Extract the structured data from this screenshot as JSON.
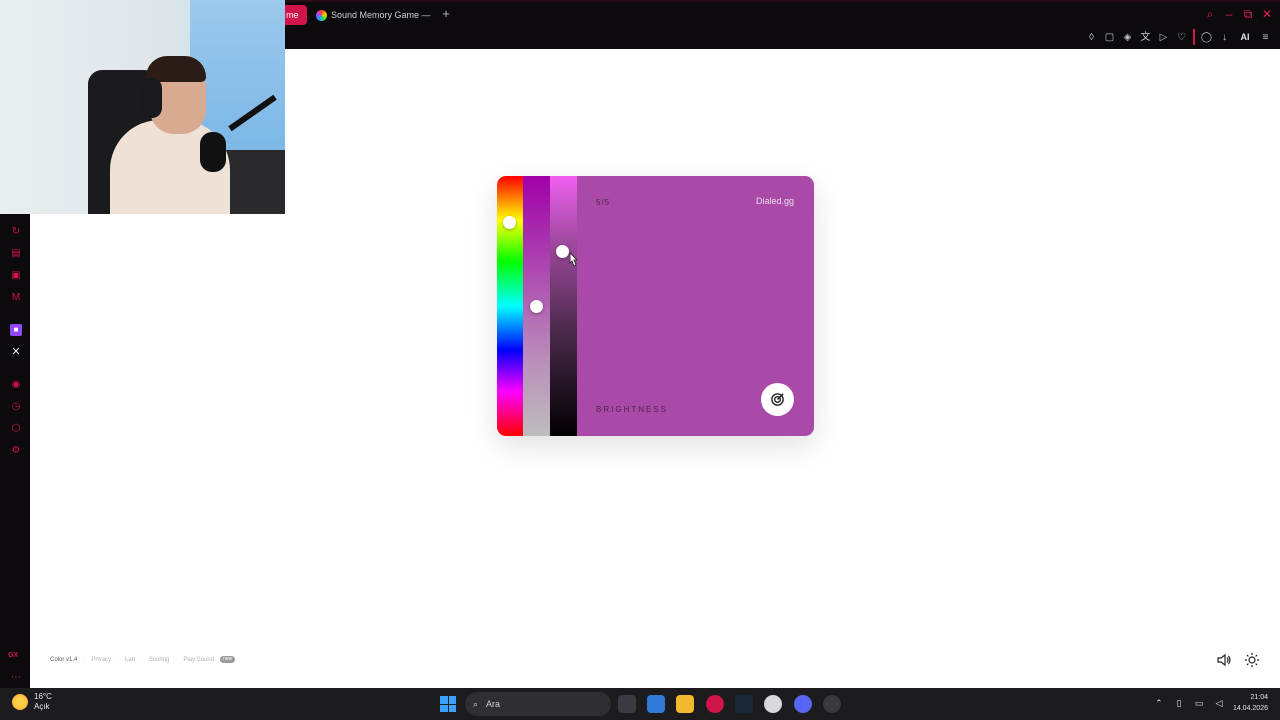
{
  "browser": {
    "active_tab_label": "me",
    "tab_label": "Sound Memory Game — H",
    "new_tab_symbol": "+",
    "toolbar_ai_label": "AI"
  },
  "game": {
    "round_counter": "5/5",
    "brand": "Dialed.gg",
    "stage_label": "BRIGHTNESS",
    "target_color": "#a94aa8",
    "hue_level": 0.84,
    "saturation_level": 0.5,
    "brightness_level": 0.72
  },
  "footer": {
    "version": "Color v1.4",
    "links": [
      "Privacy",
      "Lab",
      "Scoring",
      "Play Sound"
    ],
    "badge": "new"
  },
  "taskbar": {
    "temperature": "16°C",
    "weather_text": "Açık",
    "search_placeholder": "Ara",
    "time": "21:04",
    "date": "14.04.2026"
  },
  "sidebar": {
    "bottom_label": "GX"
  },
  "colors": {
    "accent": "#d1144a",
    "chrome_bg": "#0c0a0d",
    "taskbar_bg": "#1c1c1f"
  }
}
